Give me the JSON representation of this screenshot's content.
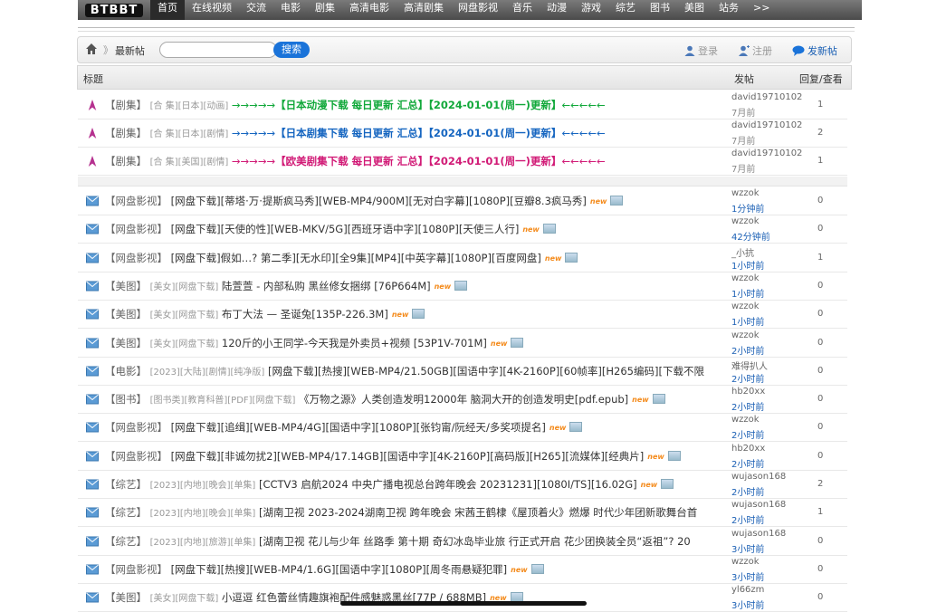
{
  "nav": {
    "logo": "BTBBT",
    "items": [
      "首页",
      "在线视频",
      "交流",
      "电影",
      "剧集",
      "高清电影",
      "高清剧集",
      "网盘影视",
      "音乐",
      "动漫",
      "游戏",
      "综艺",
      "图书",
      "美图",
      "站务",
      ">>"
    ]
  },
  "toolbar": {
    "breadcrumb": "最新帖",
    "search_placeholder": "",
    "search_label": "搜索",
    "login": "登录",
    "register": "注册",
    "post": "发新帖"
  },
  "header": {
    "title": "标题",
    "author": "发帖",
    "stats": "回复/查看"
  },
  "pinned": [
    {
      "forum": "【剧集】",
      "tags": "[合 集][日本][动画]",
      "arrow_l": "→→→→→",
      "title": "【日本动漫下载 每日更新 汇总】",
      "date": "【2024-01-01(周一)更新】",
      "arrow_r": "←←←←←",
      "color": "green",
      "author": "david19710102",
      "time": "7月前",
      "count": "1"
    },
    {
      "forum": "【剧集】",
      "tags": "[合 集][日本][剧情]",
      "arrow_l": "→→→→→",
      "title": "【日本剧集下载 每日更新 汇总】",
      "date": "【2024-01-01(周一)更新】",
      "arrow_r": "←←←←←",
      "color": "blue2",
      "author": "david19710102",
      "time": "7月前",
      "count": "2"
    },
    {
      "forum": "【剧集】",
      "tags": "[合 集][美国][剧情]",
      "arrow_l": "→→→→→",
      "title": "【欧美剧集下载 每日更新 汇总】",
      "date": "【2024-01-01(周一)更新】",
      "arrow_r": "←←←←←",
      "color": "pink",
      "author": "david19710102",
      "time": "7月前",
      "count": "1"
    }
  ],
  "threads": [
    {
      "forum": "【网盘影视】",
      "tags": "",
      "title": "[网盘下载][蒂塔·万·提斯疯马秀][WEB-MP4/900M][无对白字幕][1080P][豆瓣8.3疯马秀]",
      "author": "wzzok",
      "time": "1分钟前",
      "count": "0",
      "new": true
    },
    {
      "forum": "【网盘影视】",
      "tags": "",
      "title": "[网盘下载][天使的性][WEB-MKV/5G][西班牙语中字][1080P][天使三人行]",
      "author": "wzzok",
      "time": "42分钟前",
      "count": "0",
      "new": true
    },
    {
      "forum": "【网盘影视】",
      "tags": "",
      "title": "[网盘下载]假如…? 第二季][无水印][全9集][MP4][中英字幕][1080P][百度网盘]",
      "author": "_小抗",
      "time": "1小时前",
      "count": "1",
      "new": true
    },
    {
      "forum": "【美图】",
      "tags": "[美女][网盘下载]",
      "title": "陆萱萱 - 内部私购 黑丝修女捆绑 [76P664M]",
      "author": "wzzok",
      "time": "1小时前",
      "count": "0",
      "new": true
    },
    {
      "forum": "【美图】",
      "tags": "[美女][网盘下载]",
      "title": "布丁大法 — 圣诞兔[135P-226.3M]",
      "author": "wzzok",
      "time": "1小时前",
      "count": "0",
      "new": true
    },
    {
      "forum": "【美图】",
      "tags": "[美女][网盘下载]",
      "title": "120斤的小王同学-今天我是外卖员+视频 [53P1V-701M]",
      "author": "wzzok",
      "time": "2小时前",
      "count": "0",
      "new": true
    },
    {
      "forum": "【电影】",
      "tags": "[2023][大陆][剧情][纯净版]",
      "title": "[网盘下载][热搜][WEB-MP4/21.50GB][国语中字][4K-2160P][60帧率][H265编码][下载不限",
      "author": "难得扒人",
      "time": "2小时前",
      "count": "0",
      "new": false
    },
    {
      "forum": "【图书】",
      "tags": "[图书类][教育科普][PDF][网盘下载]",
      "title": "《万物之源》人类创造发明12000年 脑洞大开的创造发明史[pdf.epub]",
      "author": "hb20xx",
      "time": "2小时前",
      "count": "0",
      "new": true
    },
    {
      "forum": "【网盘影视】",
      "tags": "",
      "title": "[网盘下载][追缉][WEB-MP4/4G][国语中字][1080P][张钧甯/阮经天/多奖项提名]",
      "author": "wzzok",
      "time": "2小时前",
      "count": "0",
      "new": true
    },
    {
      "forum": "【网盘影视】",
      "tags": "",
      "title": "[网盘下载][非诚勿扰2][WEB-MP4/17.14GB][国语中字][4K-2160P][高码版][H265][流媒体][经典片]",
      "author": "hb20xx",
      "time": "2小时前",
      "count": "0",
      "new": true
    },
    {
      "forum": "【综艺】",
      "tags": "[2023][内地][晚会][单集]",
      "title": "[CCTV3 启航2024 中央广播电视总台跨年晚会 20231231][1080I/TS][16.02G]",
      "author": "wujason168",
      "time": "2小时前",
      "count": "2",
      "new": true
    },
    {
      "forum": "【综艺】",
      "tags": "[2023][内地][晚会][单集]",
      "title": "[湖南卫视 2023-2024湖南卫视 跨年晚会 宋茜王鹤棣《屋顶着火》燃爆 时代少年团新歌舞台首",
      "author": "wujason168",
      "time": "2小时前",
      "count": "1",
      "new": false
    },
    {
      "forum": "【综艺】",
      "tags": "[2023][内地][旅游][单集]",
      "title": "[湖南卫视 花儿与少年 丝路季 第十期 奇幻冰岛毕业旅 行正式开启 花少团换装全员“返祖”? 20",
      "author": "wujason168",
      "time": "3小时前",
      "count": "0",
      "new": false
    },
    {
      "forum": "【网盘影视】",
      "tags": "",
      "title": "[网盘下载][热搜][WEB-MP4/1.6G][国语中字][1080P][周冬雨悬疑犯罪]",
      "author": "wzzok",
      "time": "3小时前",
      "count": "0",
      "new": true
    },
    {
      "forum": "【美图】",
      "tags": "[美女][网盘下载]",
      "title": "小逗逗 红色蕾丝情趣旗袍配件感魅惑黑丝[77P / 688MB]",
      "author": "yl66zm",
      "time": "3小时前",
      "count": "0",
      "new": true
    }
  ],
  "new_badge": "new",
  "colors": {
    "accent": "#1a73d9",
    "link": "#1a5fb4",
    "green": "#11a83a",
    "blue": "#1565c0",
    "pink": "#d11a76"
  }
}
